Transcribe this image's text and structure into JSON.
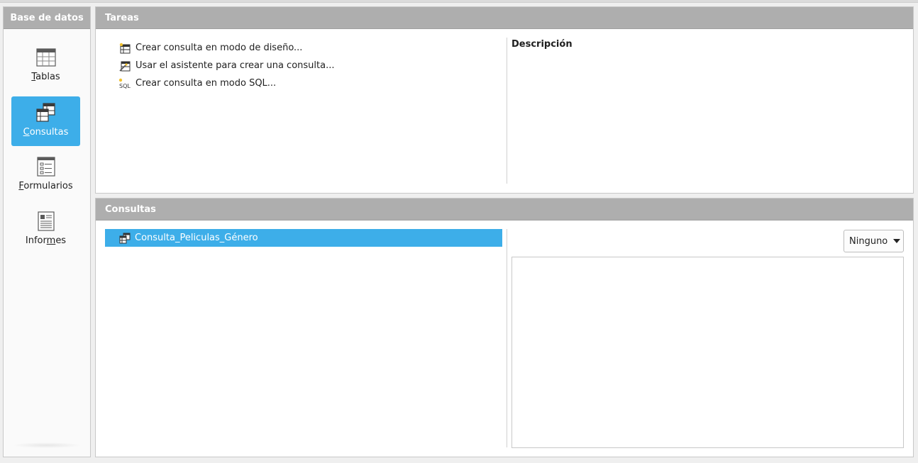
{
  "sidebar": {
    "header": "Base de datos",
    "items": [
      {
        "label_pre": "",
        "label_key": "T",
        "label_post": "ablas",
        "icon": "table-icon",
        "active": false
      },
      {
        "label_pre": "",
        "label_key": "C",
        "label_post": "onsultas",
        "icon": "query-icon",
        "active": true
      },
      {
        "label_pre": "",
        "label_key": "F",
        "label_post": "ormularios",
        "icon": "form-icon",
        "active": false
      },
      {
        "label_pre": "Infor",
        "label_key": "m",
        "label_post": "es",
        "icon": "report-icon",
        "active": false
      }
    ]
  },
  "tasks": {
    "header": "Tareas",
    "items": [
      {
        "label": "Crear consulta en modo de diseño...",
        "icon": "design-query-icon"
      },
      {
        "label": "Usar el asistente para crear una consulta...",
        "icon": "wizard-icon"
      },
      {
        "label": "Crear consulta en modo SQL...",
        "icon": "sql-icon"
      }
    ],
    "description_title": "Descripción"
  },
  "queries": {
    "header": "Consultas",
    "items": [
      {
        "label": "Consulta_Peliculas_Género",
        "icon": "query-icon",
        "selected": true
      }
    ],
    "preview_mode": "Ninguno"
  },
  "colors": {
    "accent": "#3daee9",
    "header_bg": "#aeaeae"
  }
}
